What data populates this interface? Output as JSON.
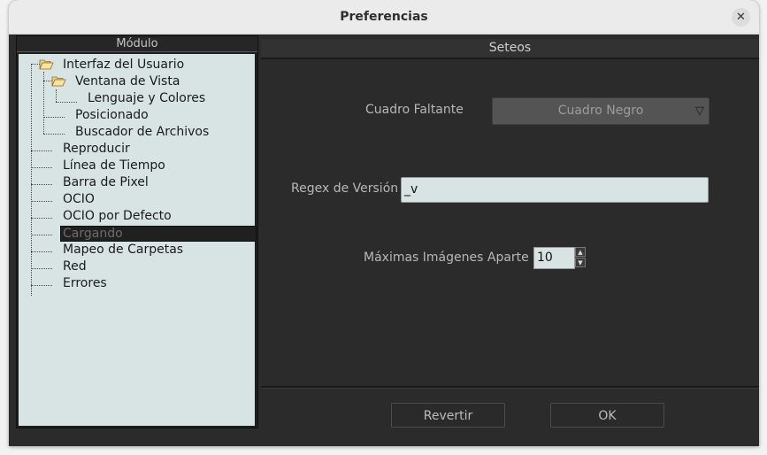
{
  "window": {
    "title": "Preferencias",
    "close_glyph": "✕"
  },
  "sidebar": {
    "header": "Módulo",
    "items": [
      {
        "label": "Interfaz del Usuario",
        "icon": "folder-open-icon"
      },
      {
        "label": "Ventana de Vista",
        "icon": "folder-open-icon"
      },
      {
        "label": "Lenguaje y Colores"
      },
      {
        "label": "Posicionado"
      },
      {
        "label": "Buscador de Archivos"
      },
      {
        "label": "Reproducir"
      },
      {
        "label": "Línea de Tiempo"
      },
      {
        "label": "Barra de Pixel"
      },
      {
        "label": "OCIO"
      },
      {
        "label": "OCIO por Defecto"
      },
      {
        "label": "Cargando",
        "selected": true
      },
      {
        "label": "Mapeo de Carpetas"
      },
      {
        "label": "Red"
      },
      {
        "label": "Errores"
      }
    ]
  },
  "main": {
    "header": "Seteos",
    "missing_frame": {
      "label": "Cuadro Faltante",
      "value": "Cuadro Negro",
      "arrow": "▽"
    },
    "version_regex": {
      "label": "Regex de Versión",
      "value": "_v"
    },
    "max_images": {
      "label": "Máximas Imágenes Aparte",
      "value": "10"
    }
  },
  "footer": {
    "revert_label": "Revertir",
    "ok_label": "OK"
  },
  "colors": {
    "window_bg": "#2b2b2b",
    "tree_bg": "#d8e4e4",
    "selected_bg": "#202020",
    "titlebar_bg": "#ebebeb"
  }
}
